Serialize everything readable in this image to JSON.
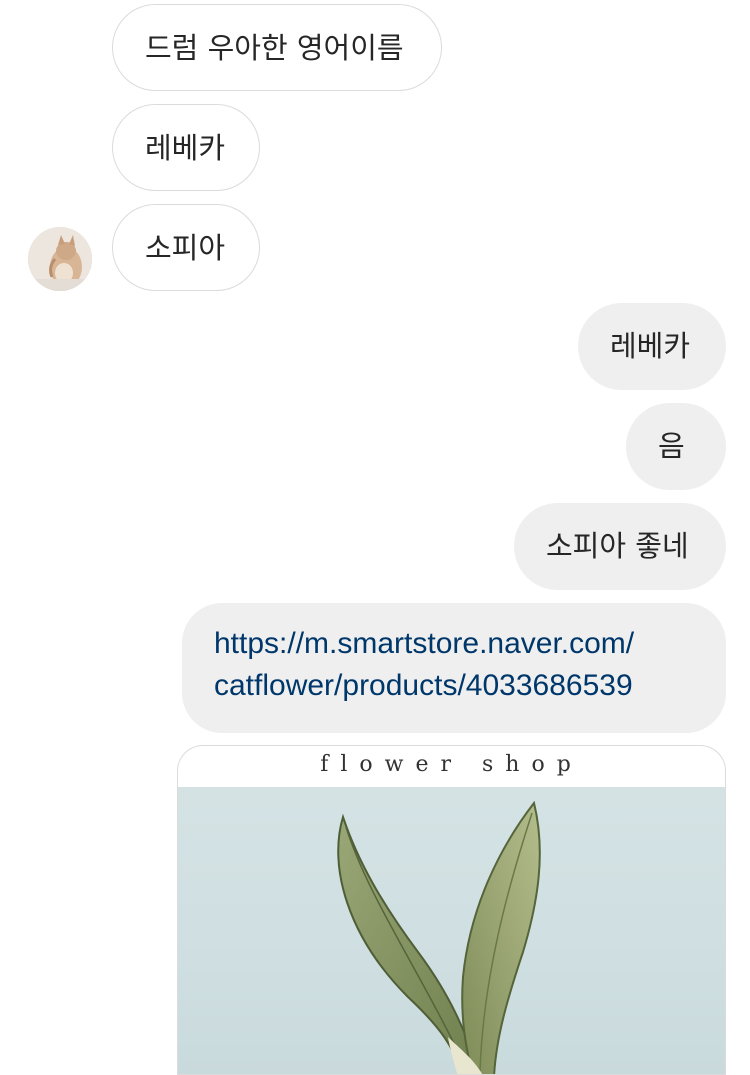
{
  "conversation": {
    "received": [
      {
        "text": "드럼 우아한 영어이름"
      },
      {
        "text": "레베카"
      },
      {
        "text": "소피아"
      }
    ],
    "sent": [
      {
        "text": "레베카"
      },
      {
        "text": "음"
      },
      {
        "text": "소피아 좋네"
      }
    ],
    "link_message": {
      "line1": "https://m.smartstore.naver.com/",
      "line2": "catflower/products/4033686539"
    },
    "link_preview": {
      "shop_title": "flower shop"
    }
  },
  "icons": {
    "avatar": "cat-profile-avatar"
  },
  "colors": {
    "received_bubble_border": "#dbdbdb",
    "sent_bubble_bg": "#efefef",
    "link_text": "#00376b"
  }
}
